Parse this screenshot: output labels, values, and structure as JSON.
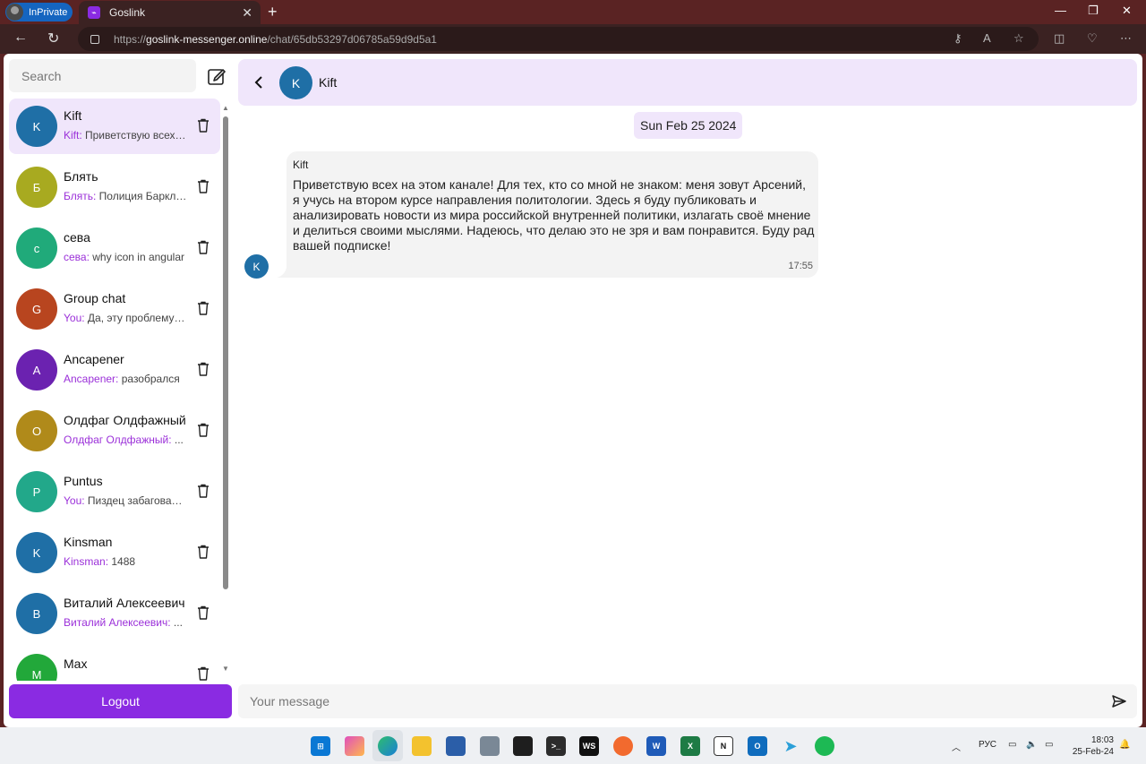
{
  "browser": {
    "inprivate_label": "InPrivate",
    "tab_title": "Goslink",
    "url_prefix": "https://",
    "url_domain": "goslink-messenger.online",
    "url_path": "/chat/65db53297d06785a59d9d5a1"
  },
  "sidebar": {
    "search_placeholder": "Search",
    "logout_label": "Logout",
    "chats": [
      {
        "initial": "K",
        "name": "Kift",
        "sender": "Kift:",
        "preview": " Приветствую всех на этом канале!",
        "color": "#1f6fa6",
        "active": true
      },
      {
        "initial": "Б",
        "name": "Блять",
        "sender": "Блять:",
        "preview": " Полиция Барклая",
        "color": "#a8aa20"
      },
      {
        "initial": "с",
        "name": "сева",
        "sender": "сева:",
        "preview": " why icon in angular",
        "color": "#20aa7a"
      },
      {
        "initial": "G",
        "name": "Group chat",
        "sender": "You:",
        "preview": " Да, эту проблему знаю",
        "color": "#b8451f"
      },
      {
        "initial": "A",
        "name": "Ancapener",
        "sender": "Ancapener:",
        "preview": " разобрался",
        "color": "#6b22b0"
      },
      {
        "initial": "О",
        "name": "Олдфаг Олдфажный",
        "sender": "Олдфаг Олдфажный:",
        "preview": " ...",
        "color": "#b08a1a"
      },
      {
        "initial": "P",
        "name": "Puntus",
        "sender": "You:",
        "preview": " Пиздец забагованный",
        "color": "#22a88a"
      },
      {
        "initial": "K",
        "name": "Kinsman",
        "sender": "Kinsman:",
        "preview": " 1488",
        "color": "#1f6fa6"
      },
      {
        "initial": "В",
        "name": "Виталий Алексеевич",
        "sender": "Виталий Алексеевич:",
        "preview": " ...",
        "color": "#1f6fa6"
      },
      {
        "initial": "M",
        "name": "Max",
        "sender": "",
        "preview": "",
        "color": "#22a83a"
      }
    ]
  },
  "chat": {
    "header_initial": "K",
    "header_name": "Kift",
    "date": "Sun Feb 25 2024",
    "message": {
      "avatar_initial": "K",
      "sender": "Kift",
      "text": "Приветствую всех на этом канале! Для тех, кто со мной не знаком: меня зовут Арсений, я учусь на втором курсе направления политологии. Здесь я буду публиковать и анализировать новости из мира российской внутренней политики, излагать своё мнение и делиться своими мыслями. Надеюсь, что делаю это не зря и вам понравится. Буду рад вашей подписке!",
      "time": "17:55"
    },
    "composer_placeholder": "Your message"
  },
  "taskbar": {
    "lang": "РУС",
    "time": "18:03",
    "date": "25-Feb-24"
  },
  "colors": {
    "accent": "#8a2be2",
    "header_bg": "#f0e6fb",
    "browser_frame": "#5a2323"
  }
}
